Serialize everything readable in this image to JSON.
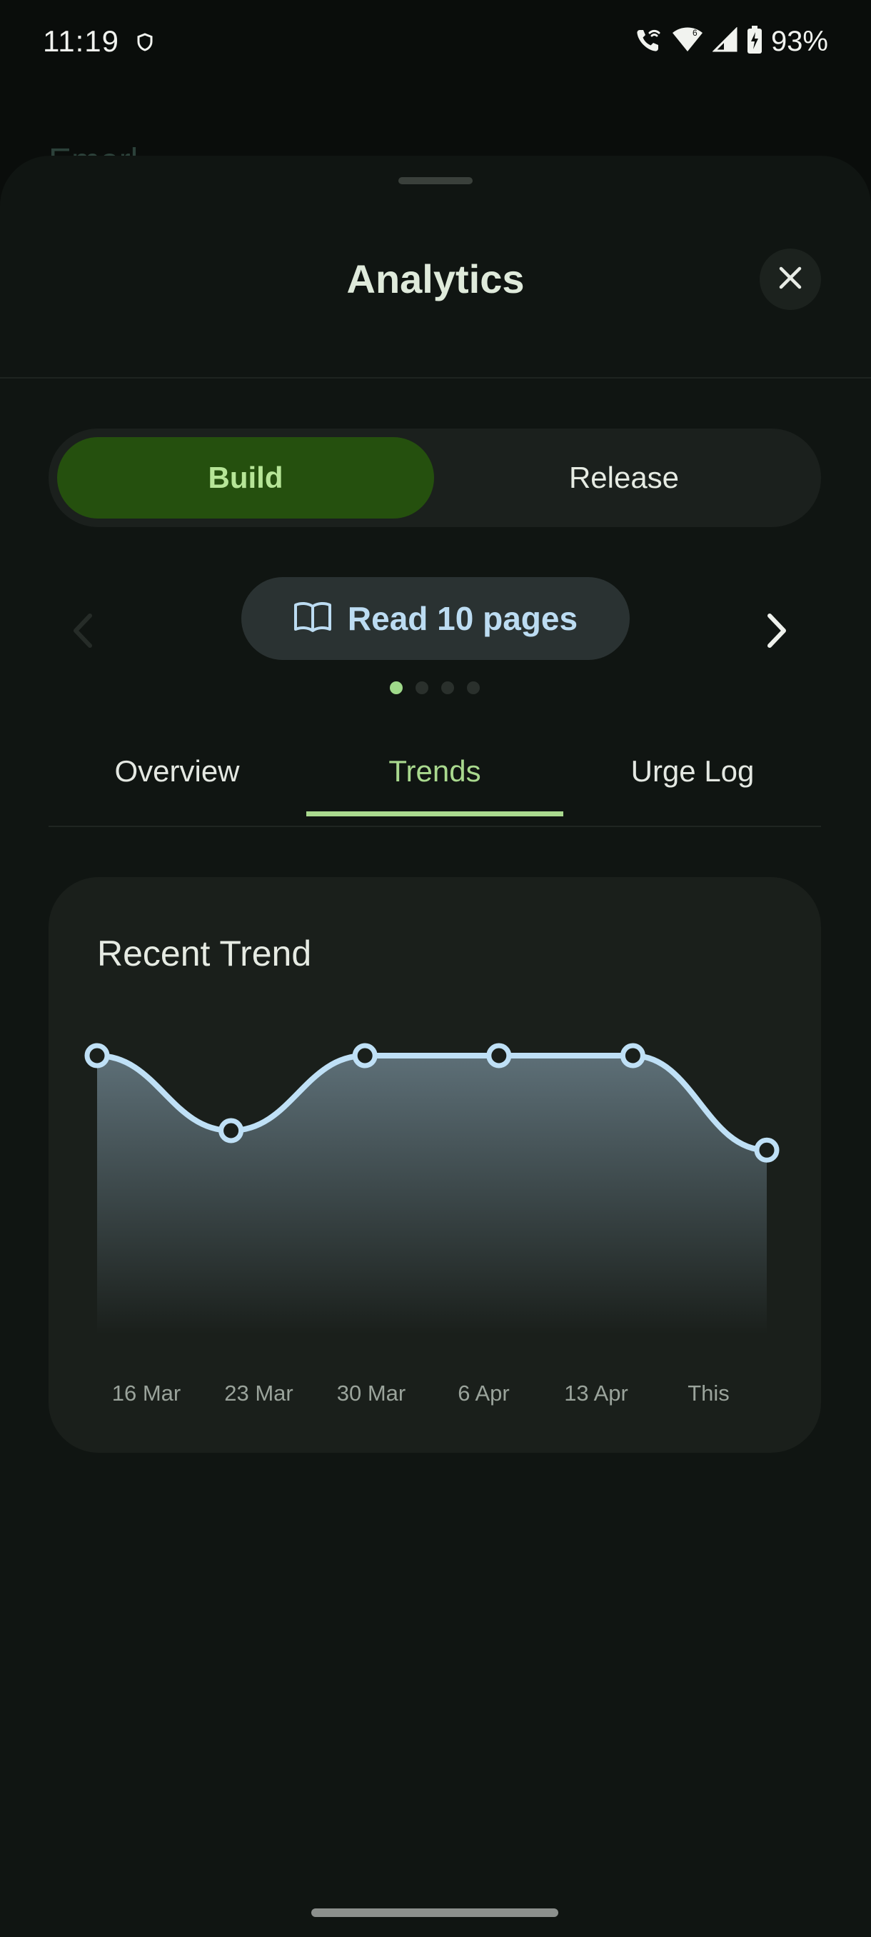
{
  "status_bar": {
    "time": "11:19",
    "battery": "93%",
    "icons": [
      "shield-icon",
      "wifi-call-icon",
      "wifi-icon",
      "signal-icon",
      "battery-charging-icon"
    ]
  },
  "background": {
    "title_partial": "Emerl"
  },
  "sheet": {
    "title": "Analytics",
    "close_icon": "close-icon"
  },
  "segment": {
    "options": [
      "Build",
      "Release"
    ],
    "selected": "Build"
  },
  "goal": {
    "icon": "book-icon",
    "label": "Read 10 pages",
    "page_count": 4,
    "current_page": 1
  },
  "tabs": {
    "items": [
      "Overview",
      "Trends",
      "Urge Log"
    ],
    "selected": "Trends"
  },
  "card": {
    "title": "Recent Trend"
  },
  "chart_data": {
    "type": "area",
    "title": "Recent Trend",
    "categories": [
      "16 Mar",
      "23 Mar",
      "30 Mar",
      "6 Apr",
      "13 Apr",
      "This"
    ],
    "values": [
      1.0,
      0.5,
      1.0,
      1.0,
      1.0,
      0.37
    ],
    "ylim": [
      0,
      1
    ],
    "grid": false,
    "colors": {
      "line": "#bfe0f6",
      "fill_top": "#5d6f77",
      "fill_bottom": "#1a1f1b",
      "marker_fill": "#1a1f1b"
    }
  },
  "colors": {
    "accent": "#a9d98e",
    "selected_segment_bg": "#25500e",
    "selected_segment_text": "#b6e597",
    "goal_text": "#bcdcf2"
  }
}
